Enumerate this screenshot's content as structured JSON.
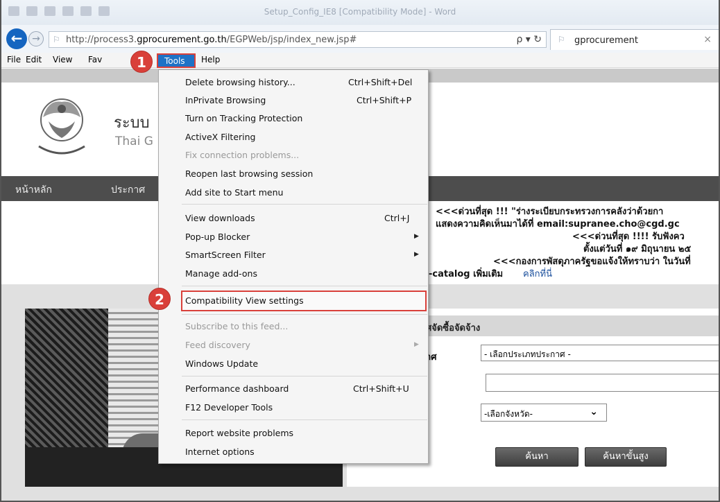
{
  "window": {
    "title": "Setup_Config_IE8 [Compatibility Mode] - Word"
  },
  "address_bar": {
    "url_prefix": "http://process3.",
    "url_domain": "gprocurement.go.th",
    "url_suffix": "/EGPWeb/jsp/index_new.jsp#",
    "controls": "ρ ▾ ↻"
  },
  "tab": {
    "label": "gprocurement",
    "close": "×"
  },
  "menubar": {
    "file": "File",
    "edit": "Edit",
    "view": "View",
    "favorites": "Fav",
    "tools": "Tools",
    "help": "Help"
  },
  "site": {
    "title": "ระบบ",
    "subtitle": "Thai G"
  },
  "nav": {
    "home": "หน้าหลัก",
    "announce": "ประกาศ"
  },
  "news": [
    "<<<ด่วนที่สุด !!! \"ร่างระเบียบกระทรวงการคลังว่าด้วยกา",
    "แสดงความคิดเห็นมาได้ที่ email:supranee.cho@cgd.gc",
    "<<<ด่วนที่สุด !!!! รับฟังคว",
    "ตั้งแต่วันที่ ๑๙ มิถุนายน ๒๕",
    "<<<กองการพัสดุภาครัฐขอแจ้งให้ทราบว่า ในวันที่",
    "-catalog เพิ่มเติม",
    "คลิกที่นี่"
  ],
  "search": {
    "header": "ศจัดซื้อจัดจ้าง",
    "type_label": "าศ",
    "type_select": "- เลือกประเภทประกาศ -",
    "province_select": "-เลือกจังหวัด-",
    "search_button": "ค้นหา",
    "advanced_button": "ค้นหาขั้นสูง"
  },
  "tools_menu": {
    "items": [
      {
        "label": "Delete browsing history...",
        "shortcut": "Ctrl+Shift+Del"
      },
      {
        "label": "InPrivate Browsing",
        "shortcut": "Ctrl+Shift+P"
      },
      {
        "label": "Turn on Tracking Protection",
        "shortcut": ""
      },
      {
        "label": "ActiveX Filtering",
        "shortcut": ""
      },
      {
        "label": "Fix connection problems...",
        "shortcut": ""
      },
      {
        "label": "Reopen last browsing session",
        "shortcut": ""
      },
      {
        "label": "Add site to Start menu",
        "shortcut": ""
      },
      {
        "label": "View downloads",
        "shortcut": "Ctrl+J"
      },
      {
        "label": "Pop-up Blocker",
        "shortcut": ""
      },
      {
        "label": "SmartScreen Filter",
        "shortcut": ""
      },
      {
        "label": "Manage add-ons",
        "shortcut": ""
      },
      {
        "label": "Compatibility View settings",
        "shortcut": ""
      },
      {
        "label": "Subscribe to this feed...",
        "shortcut": ""
      },
      {
        "label": "Feed discovery",
        "shortcut": ""
      },
      {
        "label": "Windows Update",
        "shortcut": ""
      },
      {
        "label": "Performance dashboard",
        "shortcut": "Ctrl+Shift+U"
      },
      {
        "label": "F12 Developer Tools",
        "shortcut": ""
      },
      {
        "label": "Report website problems",
        "shortcut": ""
      },
      {
        "label": "Internet options",
        "shortcut": ""
      }
    ]
  },
  "annotations": {
    "step1": "1",
    "step2": "2",
    "color": "#d9403a"
  },
  "colors": {
    "menu_highlight": "#1e72c6",
    "nav_strip": "#4d4d4d"
  }
}
